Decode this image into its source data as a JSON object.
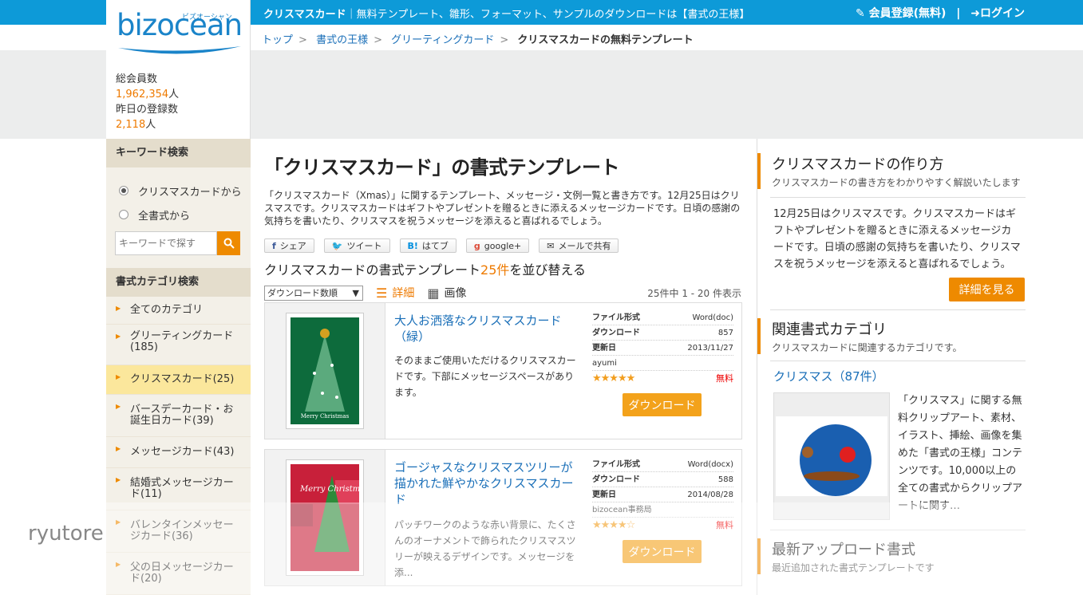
{
  "topbar": {
    "category": "クリスマスカード",
    "tagline": "｜無料テンプレート、雛形、フォーマット、サンプルのダウンロードは【書式の王様】",
    "register": "会員登録(無料)",
    "divider": "|",
    "login": "ログイン"
  },
  "logo": {
    "text": "bizocean",
    "kana": "ビズオーシャン"
  },
  "members": {
    "total_label": "総会員数",
    "total_value": "1,962,354",
    "unit": "人",
    "today_label": "昨日の登録数",
    "today_value": "2,118"
  },
  "breadcrumb": {
    "items": [
      "トップ",
      "書式の王様",
      "グリーティングカード"
    ],
    "current": "クリスマスカードの無料テンプレート"
  },
  "sidebar": {
    "keyword_head": "キーワード検索",
    "radio_from_this": "クリスマスカードから",
    "radio_all": "全書式から",
    "search_placeholder": "キーワードで探す",
    "category_head": "書式カテゴリ検索",
    "categories": [
      "全てのカテゴリ",
      "グリーティングカード(185)",
      "クリスマスカード(25)",
      "バースデーカード・お誕生日カード(39)",
      "メッセージカード(43)",
      "結婚式メッセージカード(11)",
      "バレンタインメッセージカード(36)",
      "父の日メッセージカード(20)"
    ]
  },
  "main": {
    "title": "「クリスマスカード」の書式テンプレート",
    "intro": "「クリスマスカード（Xmas）」に関するテンプレート、メッセージ・文例一覧と書き方です。12月25日はクリスマスです。クリスマスカードはギフトやプレゼントを贈るときに添えるメッセージカードです。日頃の感謝の気持ちを書いたり、クリスマスを祝うメッセージを添えると喜ばれるでしょう。",
    "share": {
      "facebook": "シェア",
      "twitter": "ツイート",
      "hatena": "はてブ",
      "google": "google+",
      "mail": "メールで共有"
    },
    "subtitle_pre": "クリスマスカードの書式テンプレート",
    "subtitle_count": "25件",
    "subtitle_post": "を並び替える",
    "sort_value": "ダウンロード数順",
    "view_detail": "詳細",
    "view_image": "画像",
    "count_text": "25件中 1 - 20 件表示"
  },
  "items": [
    {
      "title": "大人お洒落なクリスマスカード（緑）",
      "desc": "そのままご使用いただけるクリスマスカードです。下部にメッセージスペースがあります。",
      "format_label": "ファイル形式",
      "format": "Word(doc)",
      "download_label": "ダウンロード",
      "downloads": "857",
      "updated_label": "更新日",
      "updated": "2013/11/27",
      "author": "ayumi",
      "stars": "★★★★★",
      "price": "無料",
      "button": "ダウンロード",
      "thumb_text": "Merry Christmas"
    },
    {
      "title": "ゴージャスなクリスマスツリーが描かれた鮮やかなクリスマスカード",
      "desc": "パッチワークのような赤い背景に、たくさんのオーナメントで飾られたクリスマスツリーが映えるデザインです。メッセージを添...",
      "format_label": "ファイル形式",
      "format": "Word(docx)",
      "download_label": "ダウンロード",
      "downloads": "588",
      "updated_label": "更新日",
      "updated": "2014/08/28",
      "author": "bizocean事務局",
      "stars": "★★★★☆",
      "price": "無料",
      "button": "ダウンロード",
      "thumb_text": "Merry Christmas"
    }
  ],
  "right": {
    "howto_title": "クリスマスカードの作り方",
    "howto_sub": "クリスマスカードの書き方をわかりやすく解説いたします",
    "howto_text": "12月25日はクリスマスです。クリスマスカードはギフトやプレゼントを贈るときに添えるメッセージカードです。日頃の感謝の気持ちを書いたり、クリスマスを祝うメッセージを添えると喜ばれるでしょう。",
    "more_button": "詳細を見る",
    "related_title": "関連書式カテゴリ",
    "related_sub": "クリスマスカードに関連するカテゴリです。",
    "related_link": "クリスマス（87件）",
    "related_text": "「クリスマス」に関する無料クリップアート、素材、イラスト、挿絵、画像を集めた「書式の王様」コンテンツです。10,000以上の全ての書式からクリップアートに関す…",
    "latest_title": "最新アップロード書式",
    "latest_sub": "最近追加された書式テンプレートです"
  },
  "overlay_name": "ryutore"
}
